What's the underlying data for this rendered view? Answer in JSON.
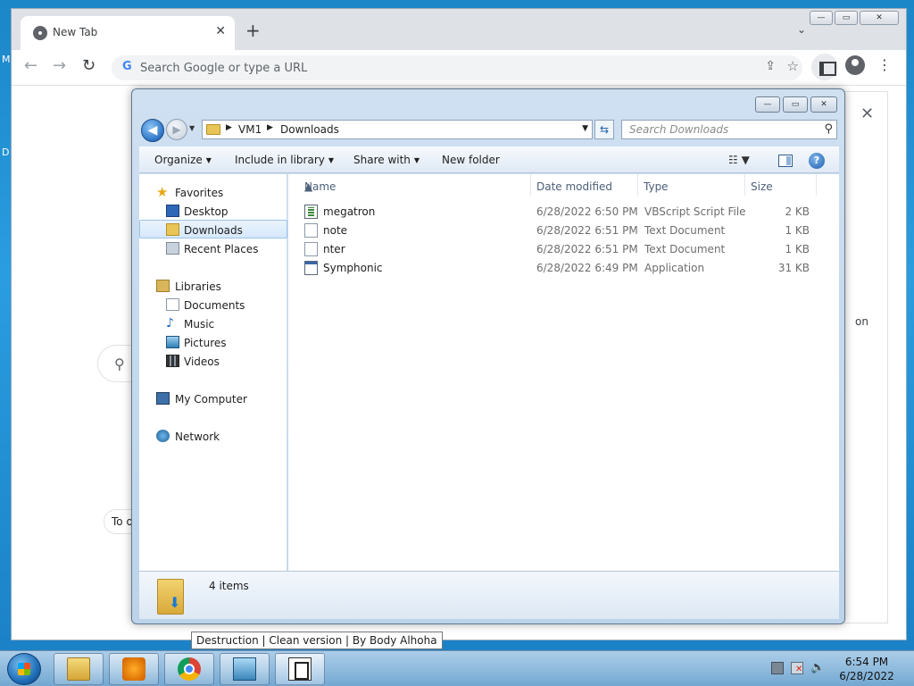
{
  "desktop": {
    "left_fragment_1": "M",
    "left_fragment_2": "D"
  },
  "chrome": {
    "tab_title": "New Tab",
    "tab_close": "✕",
    "new_tab": "+",
    "tab_search": "⌄",
    "window_controls": [
      "—",
      "▭",
      "✕"
    ],
    "back": "←",
    "forward": "→",
    "reload": "↻",
    "omnibox_placeholder": "Search Google or type a URL",
    "menu": "⋮",
    "page": {
      "search_glyph": "⚲",
      "chip_fragment": "To o",
      "dialog_close": "✕",
      "dialog_fragment": "on"
    }
  },
  "explorer": {
    "window_controls": [
      "—",
      "▭",
      "✕"
    ],
    "breadcrumb": [
      "VM1",
      "Downloads"
    ],
    "search_placeholder": "Search Downloads",
    "commands": [
      "Organize",
      "Include in library",
      "Share with",
      "New folder"
    ],
    "help": "?",
    "nav": {
      "favorites": [
        "Favorites",
        "Desktop",
        "Downloads",
        "Recent Places"
      ],
      "libraries": [
        "Libraries",
        "Documents",
        "Music",
        "Pictures",
        "Videos"
      ],
      "computer": "My Computer",
      "network": "Network"
    },
    "columns": [
      "Name",
      "Date modified",
      "Type",
      "Size"
    ],
    "files": [
      {
        "name": "megatron",
        "date": "6/28/2022 6:50 PM",
        "type": "VBScript Script File",
        "size": "2 KB",
        "icon": "vbscript-icon"
      },
      {
        "name": "note",
        "date": "6/28/2022 6:51 PM",
        "type": "Text Document",
        "size": "1 KB",
        "icon": "text-file-icon"
      },
      {
        "name": "nter",
        "date": "6/28/2022 6:51 PM",
        "type": "Text Document",
        "size": "1 KB",
        "icon": "text-file-icon"
      },
      {
        "name": "Symphonic",
        "date": "6/28/2022 6:49 PM",
        "type": "Application",
        "size": "31 KB",
        "icon": "application-icon"
      }
    ],
    "item_count": "4 items"
  },
  "tooltip": "Destruction | Clean version | By Body Alhoha",
  "taskbar": {
    "time": "6:54 PM",
    "date": "6/28/2022"
  }
}
